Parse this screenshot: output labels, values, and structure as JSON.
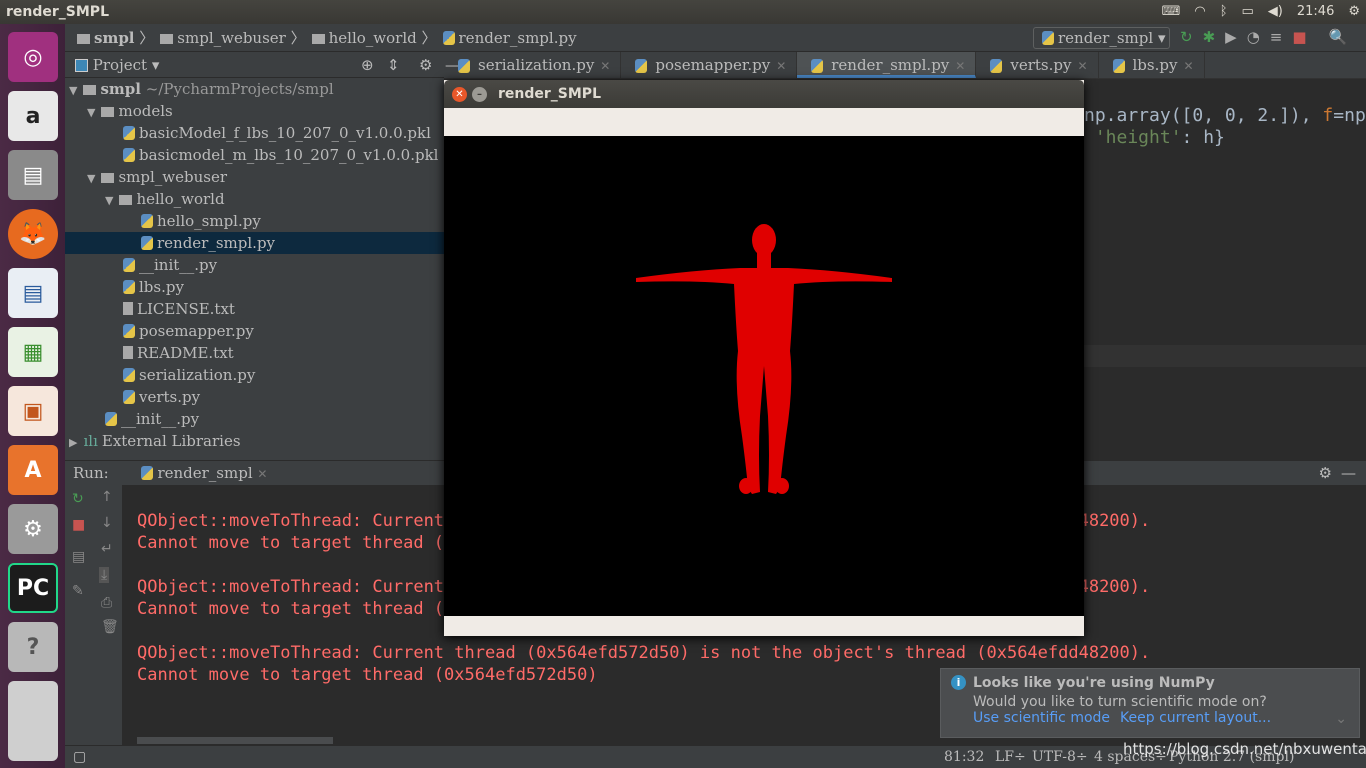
{
  "topbar": {
    "title": "render_SMPL",
    "clock": "21:46",
    "icons": [
      "keyboard-icon",
      "wifi-icon",
      "bluetooth-icon",
      "battery-icon",
      "volume-icon",
      "power-icon"
    ]
  },
  "launcher": {
    "items": [
      "ubuntu-dash",
      "amazon",
      "files",
      "firefox",
      "writer",
      "calc",
      "impress",
      "software-center",
      "system-settings",
      "pycharm",
      "help",
      "workspaces"
    ]
  },
  "breadcrumb": [
    "smpl",
    "smpl_webuser",
    "hello_world",
    "render_smpl.py"
  ],
  "run_config": "render_smpl",
  "project": {
    "label": "Project",
    "tree": [
      {
        "label": "smpl",
        "extra": "~/PycharmProjects/smpl",
        "depth": 0,
        "type": "folder",
        "arrow": "▼"
      },
      {
        "label": "models",
        "depth": 1,
        "type": "folder",
        "arrow": "▼"
      },
      {
        "label": "basicModel_f_lbs_10_207_0_v1.0.0.pkl",
        "depth": 2,
        "type": "py"
      },
      {
        "label": "basicmodel_m_lbs_10_207_0_v1.0.0.pkl",
        "depth": 2,
        "type": "py"
      },
      {
        "label": "smpl_webuser",
        "depth": 1,
        "type": "folder",
        "arrow": "▼"
      },
      {
        "label": "hello_world",
        "depth": 2,
        "type": "folder",
        "arrow": "▼"
      },
      {
        "label": "hello_smpl.py",
        "depth": 3,
        "type": "py"
      },
      {
        "label": "render_smpl.py",
        "depth": 3,
        "type": "py",
        "selected": true
      },
      {
        "label": "__init__.py",
        "depth": 2,
        "type": "py"
      },
      {
        "label": "lbs.py",
        "depth": 2,
        "type": "py"
      },
      {
        "label": "LICENSE.txt",
        "depth": 2,
        "type": "txt"
      },
      {
        "label": "posemapper.py",
        "depth": 2,
        "type": "py"
      },
      {
        "label": "README.txt",
        "depth": 2,
        "type": "txt"
      },
      {
        "label": "serialization.py",
        "depth": 2,
        "type": "py"
      },
      {
        "label": "verts.py",
        "depth": 2,
        "type": "py"
      },
      {
        "label": "__init__.py",
        "depth": 1,
        "type": "py"
      },
      {
        "label": "External Libraries",
        "depth": 0,
        "type": "lib",
        "arrow": "▶"
      }
    ]
  },
  "tabs": [
    {
      "label": "serialization.py"
    },
    {
      "label": "posemapper.py"
    },
    {
      "label": "render_smpl.py",
      "active": true
    },
    {
      "label": "verts.py"
    },
    {
      "label": "lbs.py"
    }
  ],
  "editor": {
    "line1_a": "np.array([0, 0, 2.]), ",
    "line1_b": "f",
    "line1_c": "=np",
    "line2_a": " 'height'",
    "line2_b": ": h}"
  },
  "run": {
    "label": "Run:",
    "tab": "render_smpl",
    "lines": [
      {
        "text": "QObject::moveToThread: Current thread (0x564efd572d50) is not the object's thread (0x564efdd48200)."
      },
      {
        "text": "Cannot move to target thread (0x564efd572d50)"
      },
      {
        "text": "QObject::moveToThread: Current thread (0x564efd572d50) is not the object's thread (0x564efdd48200)."
      },
      {
        "text": "Cannot move to target thread (0x564efd572d50)"
      },
      {
        "text": "QObject::moveToThread: Current thread (0x564efd572d50) is not the object's thread (0x564efdd48200)."
      },
      {
        "text": "Cannot move to target thread (0x564efd572d50)"
      }
    ]
  },
  "window": {
    "title": "render_SMPL",
    "figure_color": "#e00000"
  },
  "notification": {
    "title": "Looks like you're using NumPy",
    "body": "Would you like to turn scientific mode on?",
    "action1": "Use scientific mode",
    "action2": "Keep current layout...",
    "icon": "info-icon"
  },
  "status": {
    "position": "81:32",
    "line_sep": "LF÷",
    "encoding": "UTF-8÷",
    "indent": "4 spaces÷",
    "interpreter": "Python 2.7 (smpl)",
    "watermark": "https://blog.csdn.net/nbxuwentao"
  }
}
